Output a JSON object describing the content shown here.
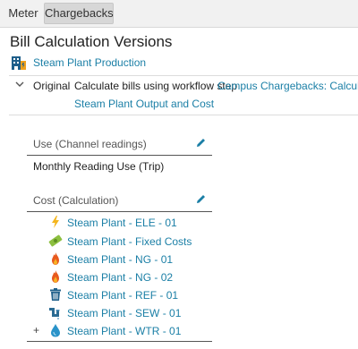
{
  "tabs": [
    {
      "label": "Meter",
      "active": false
    },
    {
      "label": "Chargebacks",
      "active": true
    }
  ],
  "page_title": "Bill Calculation Versions",
  "header_link": "Steam Plant Production",
  "version": {
    "name": "Original",
    "description": "Calculate bills using workflow step",
    "workflow_link_line1": "Campus Chargebacks: Calculate",
    "workflow_link_line2": "Steam Plant Output and Cost"
  },
  "use_section": {
    "label": "Use (Channel readings)",
    "items": [
      "Monthly Reading Use (Trip)"
    ]
  },
  "cost_section": {
    "label": "Cost (Calculation)",
    "items": [
      {
        "label": "Steam Plant - ELE - 01",
        "icon": "lightning-icon"
      },
      {
        "label": "Steam Plant - Fixed Costs",
        "icon": "money-icon"
      },
      {
        "label": "Steam Plant - NG - 01",
        "icon": "flame-icon"
      },
      {
        "label": "Steam Plant - NG - 02",
        "icon": "flame-icon"
      },
      {
        "label": "Steam Plant - REF - 01",
        "icon": "trash-can-icon"
      },
      {
        "label": "Steam Plant - SEW - 01",
        "icon": "pipe-icon"
      },
      {
        "label": "Steam Plant - WTR - 01",
        "icon": "water-drop-icon",
        "expandable": true,
        "expand_symbol": "+"
      }
    ]
  },
  "colors": {
    "link": "#1b7fa6",
    "tabbar": "#f1f1f1",
    "tab_active": "#d7d7d7"
  }
}
